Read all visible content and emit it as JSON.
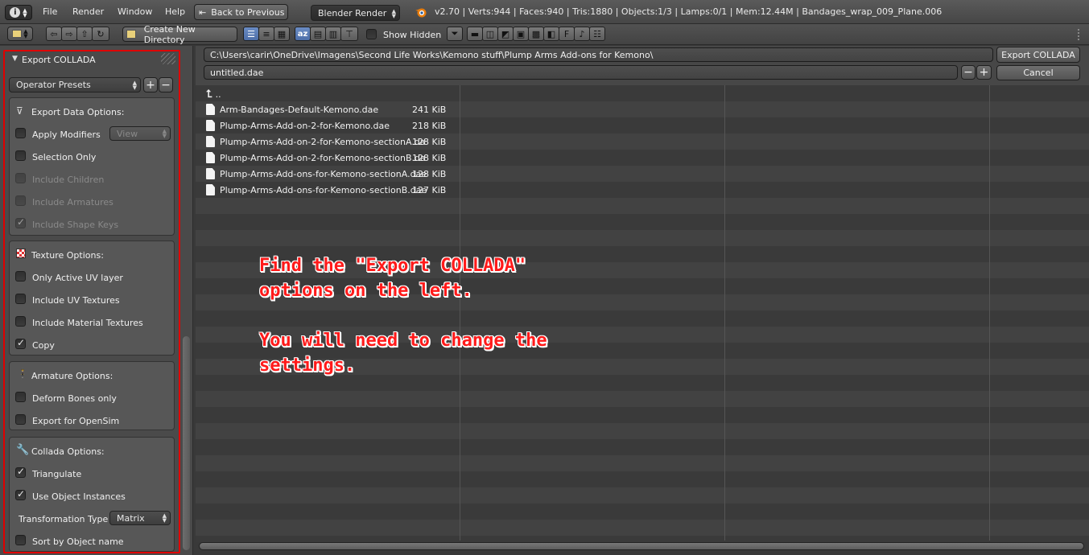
{
  "topbar": {
    "menu": [
      "File",
      "Render",
      "Window",
      "Help"
    ],
    "back_label": "Back to Previous",
    "engine": "Blender Render",
    "stats": "v2.70 | Verts:944 | Faces:940 | Tris:1880 | Objects:1/3 | Lamps:0/1 | Mem:12.44M | Bandages_wrap_009_Plane.006"
  },
  "toolbar": {
    "create_dir_label": "Create New Directory",
    "show_hidden_label": "Show Hidden"
  },
  "sidebar": {
    "header": "Export COLLADA",
    "presets_label": "Operator Presets",
    "export_data": {
      "title": "Export Data Options:",
      "apply_modifiers": "Apply Modifiers",
      "view_value": "View",
      "selection_only": "Selection Only",
      "include_children": "Include Children",
      "include_armatures": "Include Armatures",
      "include_shape_keys": "Include Shape Keys"
    },
    "texture": {
      "title": "Texture Options:",
      "only_active_uv": "Only Active UV layer",
      "include_uv_textures": "Include UV Textures",
      "include_material_textures": "Include Material Textures",
      "copy": "Copy"
    },
    "armature": {
      "title": "Armature Options:",
      "deform_bones": "Deform Bones only",
      "export_opensim": "Export for OpenSim"
    },
    "collada": {
      "title": "Collada Options:",
      "triangulate": "Triangulate",
      "use_object_instances": "Use Object Instances",
      "transformation_type_label": "Transformation Type",
      "transformation_type_value": "Matrix",
      "sort_by_name": "Sort by Object name"
    }
  },
  "path": {
    "directory": "C:\\Users\\carir\\OneDrive\\Imagens\\Second Life Works\\Kemono stuff\\Plump Arms Add-ons for Kemono\\",
    "filename": "untitled.dae",
    "export_button": "Export COLLADA",
    "cancel_button": "Cancel"
  },
  "files": {
    "parent": "..",
    "items": [
      {
        "name": "Arm-Bandages-Default-Kemono.dae",
        "size": "241 KiB"
      },
      {
        "name": "Plump-Arms-Add-on-2-for-Kemono.dae",
        "size": "218 KiB"
      },
      {
        "name": "Plump-Arms-Add-on-2-for-Kemono-sectionA.da",
        "size": "128 KiB"
      },
      {
        "name": "Plump-Arms-Add-on-2-for-Kemono-sectionB.da",
        "size": "128 KiB"
      },
      {
        "name": "Plump-Arms-Add-ons-for-Kemono-sectionA.dae",
        "size": "128 KiB"
      },
      {
        "name": "Plump-Arms-Add-ons-for-Kemono-sectionB.dae",
        "size": "127 KiB"
      }
    ]
  },
  "annotation": {
    "line1": "Find the \"Export COLLADA\"",
    "line2": "options on the left.",
    "line3": "You will need to change the",
    "line4": "settings."
  },
  "colors": {
    "annotation_red": "#ff1a1a",
    "highlight_border": "#e00000",
    "active_button": "#5a7cb8"
  }
}
